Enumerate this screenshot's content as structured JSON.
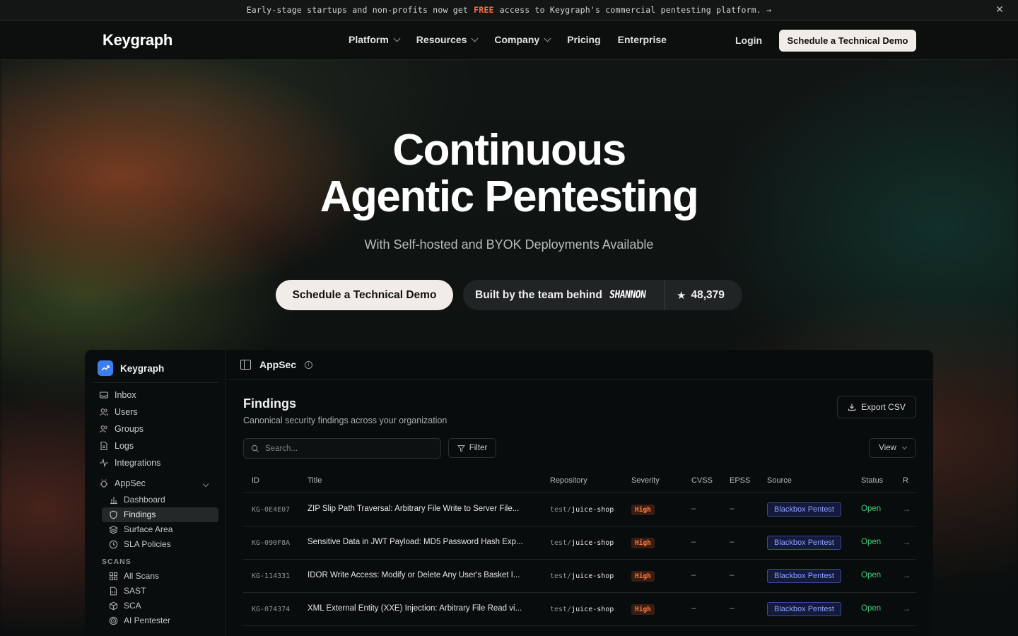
{
  "announcement": {
    "before": "Early-stage startups and non-profits now get",
    "highlight": "FREE",
    "after": "access to Keygraph's commercial pentesting platform. →",
    "close": "✕"
  },
  "nav": {
    "logo": "Keygraph",
    "items": [
      "Platform",
      "Resources",
      "Company",
      "Pricing",
      "Enterprise"
    ],
    "login": "Login",
    "cta": "Schedule a Technical Demo"
  },
  "hero": {
    "title_line1": "Continuous",
    "title_line2": "Agentic Pentesting",
    "subtitle": "With Self-hosted and BYOK Deployments Available",
    "cta": "Schedule a Technical Demo",
    "built_by": "Built by the team behind",
    "project": "SHANNON",
    "stars": "48,379"
  },
  "sidebar": {
    "brand": "Keygraph",
    "items": [
      "Inbox",
      "Users",
      "Groups",
      "Logs",
      "Integrations"
    ],
    "appsec": {
      "label": "AppSec",
      "items": [
        "Dashboard",
        "Findings",
        "Surface Area",
        "SLA Policies"
      ]
    },
    "scans_heading": "SCANS",
    "scans": [
      "All Scans",
      "SAST",
      "SCA",
      "AI Pentester"
    ]
  },
  "main": {
    "section": "AppSec",
    "title": "Findings",
    "subtitle": "Canonical security findings across your organization",
    "export": "Export CSV",
    "search_placeholder": "Search...",
    "filter": "Filter",
    "view": "View",
    "columns": [
      "ID",
      "Title",
      "Repository",
      "Severity",
      "CVSS",
      "EPSS",
      "Source",
      "Status",
      "R"
    ],
    "rows": [
      {
        "id": "KG-0E4E07",
        "title": "ZIP Slip Path Traversal: Arbitrary File Write to Server File...",
        "repo_prefix": "test/",
        "repo_name": "juice-shop",
        "severity": "High",
        "cvss": "–",
        "epss": "–",
        "source": "Blackbox Pentest",
        "status": "Open",
        "arrow": "→"
      },
      {
        "id": "KG-090F8A",
        "title": "Sensitive Data in JWT Payload: MD5 Password Hash Exp...",
        "repo_prefix": "test/",
        "repo_name": "juice-shop",
        "severity": "High",
        "cvss": "–",
        "epss": "–",
        "source": "Blackbox Pentest",
        "status": "Open",
        "arrow": "→"
      },
      {
        "id": "KG-114331",
        "title": "IDOR Write Access: Modify or Delete Any User's Basket I...",
        "repo_prefix": "test/",
        "repo_name": "juice-shop",
        "severity": "High",
        "cvss": "–",
        "epss": "–",
        "source": "Blackbox Pentest",
        "status": "Open",
        "arrow": "→"
      },
      {
        "id": "KG-074374",
        "title": "XML External Entity (XXE) Injection: Arbitrary File Read vi...",
        "repo_prefix": "test/",
        "repo_name": "juice-shop",
        "severity": "High",
        "cvss": "–",
        "epss": "–",
        "source": "Blackbox Pentest",
        "status": "Open",
        "arrow": "→"
      }
    ]
  },
  "colors": {
    "accent": "#ff6a3d",
    "cta_bg": "#f1ece8",
    "status_open": "#3ecf7a",
    "severity_high": "#ff7a3a",
    "source_badge": "#8ea0ff",
    "brand_mark": "#3c7ef0"
  }
}
